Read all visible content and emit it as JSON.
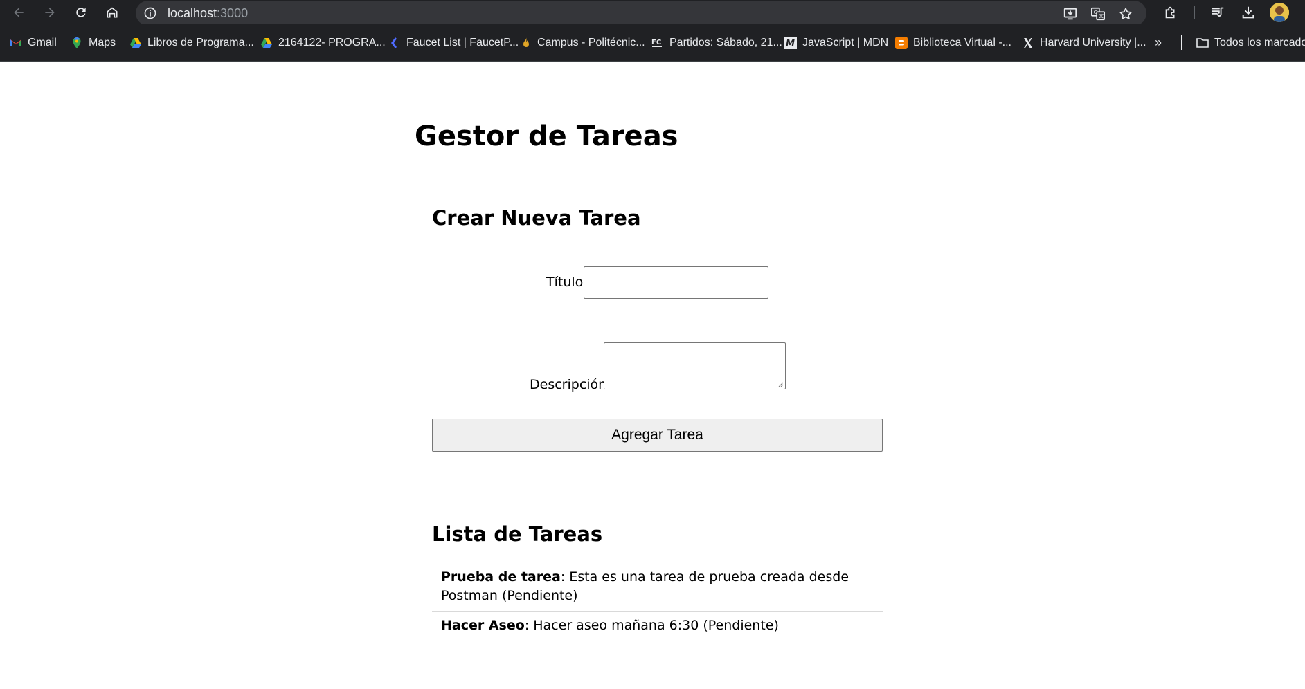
{
  "browser": {
    "url_host": "localhost",
    "url_port": ":3000"
  },
  "bookmarks": [
    {
      "label": "Gmail",
      "icon": "gmail-icon"
    },
    {
      "label": "Maps",
      "icon": "maps-pin-icon"
    },
    {
      "label": "Libros de Programa...",
      "icon": "drive-icon"
    },
    {
      "label": "2164122- PROGRA...",
      "icon": "drive-icon"
    },
    {
      "label": "Faucet List | FaucetP...",
      "icon": "faucet-icon"
    },
    {
      "label": "Campus - Politécnic...",
      "icon": "campus-flame-icon"
    },
    {
      "label": "Partidos: Sábado, 21...",
      "icon": "fc-icon"
    },
    {
      "label": "JavaScript | MDN",
      "icon": "mdn-icon"
    },
    {
      "label": "Biblioteca Virtual -...",
      "icon": "blogger-icon"
    },
    {
      "label": "Harvard University |...",
      "icon": "x-icon"
    }
  ],
  "bookmarks_more": "»",
  "bookmarks_folder": "Todos los marcadores",
  "page": {
    "title": "Gestor de Tareas",
    "form": {
      "heading": "Crear Nueva Tarea",
      "title_label": "Título:",
      "title_value": "",
      "description_label": "Descripción:",
      "description_value": "",
      "submit_label": "Agregar Tarea"
    },
    "list": {
      "heading": "Lista de Tareas",
      "tasks": [
        {
          "title": "Prueba de tarea",
          "rest": ": Esta es una tarea de prueba creada desde Postman (Pendiente)"
        },
        {
          "title": "Hacer Aseo",
          "rest": ": Hacer aseo mañana 6:30 (Pendiente)"
        }
      ]
    }
  },
  "colors": {
    "chrome_bg": "#202124",
    "omnibox_bg": "#35363a",
    "chrome_text": "#e8eaed",
    "button_bg": "#efefef"
  }
}
